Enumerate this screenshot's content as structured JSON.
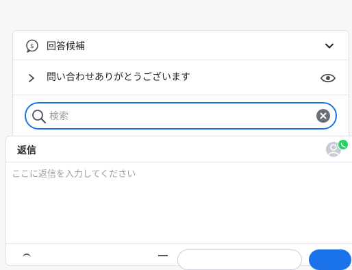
{
  "candidates": {
    "title": "回答候補",
    "icon": "dollar-chat-icon",
    "collapse_icon": "chevron-down-icon"
  },
  "suggestion": {
    "text": "問い合わせありがとうございます",
    "expand_icon": "chevron-right-icon",
    "preview_icon": "eye-icon"
  },
  "search": {
    "placeholder": "検索",
    "value": ""
  },
  "reply": {
    "title": "返信",
    "placeholder": "ここに返信を入力してください",
    "channel_badge": "whatsapp-icon",
    "avatar": "user-avatar"
  },
  "colors": {
    "accent": "#1a73e8",
    "whatsapp": "#25d366"
  }
}
